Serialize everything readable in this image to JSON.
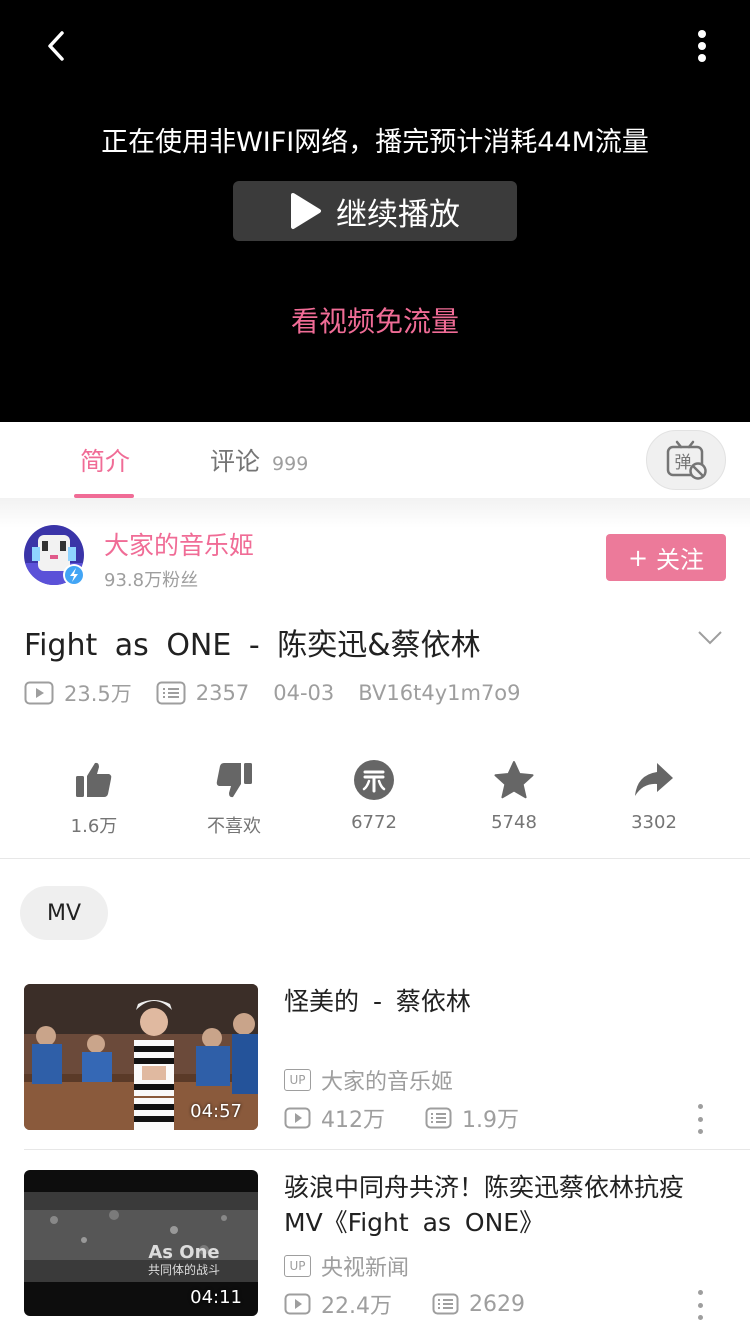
{
  "player": {
    "network_notice": "正在使用非WIFI网络，播完预计消耗44M流量",
    "continue_label": "继续播放",
    "free_data_link": "看视频免流量"
  },
  "tabs": {
    "intro_label": "简介",
    "comments_label": "评论",
    "comments_count": "999",
    "danmaku_icon_text": "弹"
  },
  "uploader": {
    "name": "大家的音乐姬",
    "fans": "93.8万粉丝",
    "follow_label": "关注",
    "follow_plus": "+"
  },
  "video": {
    "title": "Fight as ONE - 陈奕迅&蔡依林",
    "views": "23.5万",
    "danmaku_count": "2357",
    "date": "04-03",
    "bvid": "BV16t4y1m7o9"
  },
  "actions": {
    "like": "1.6万",
    "dislike": "不喜欢",
    "coin": "6772",
    "favorite": "5748",
    "share": "3302"
  },
  "tag": "MV",
  "related": [
    {
      "title": "怪美的 - 蔡依林",
      "duration": "04:57",
      "up_badge": "UP",
      "up_name": "大家的音乐姬",
      "views": "412万",
      "danmaku": "1.9万"
    },
    {
      "title": "骇浪中同舟共济！陈奕迅蔡依林抗疫MV《Fight as ONE》",
      "duration": "04:11",
      "up_badge": "UP",
      "up_name": "央视新闻",
      "views": "22.4万",
      "danmaku": "2629",
      "thumb_text_1": "As One",
      "thumb_text_2": "共同体的战斗"
    }
  ],
  "colors": {
    "accent": "#f06c96",
    "follow_bg": "#ec7a9a"
  }
}
